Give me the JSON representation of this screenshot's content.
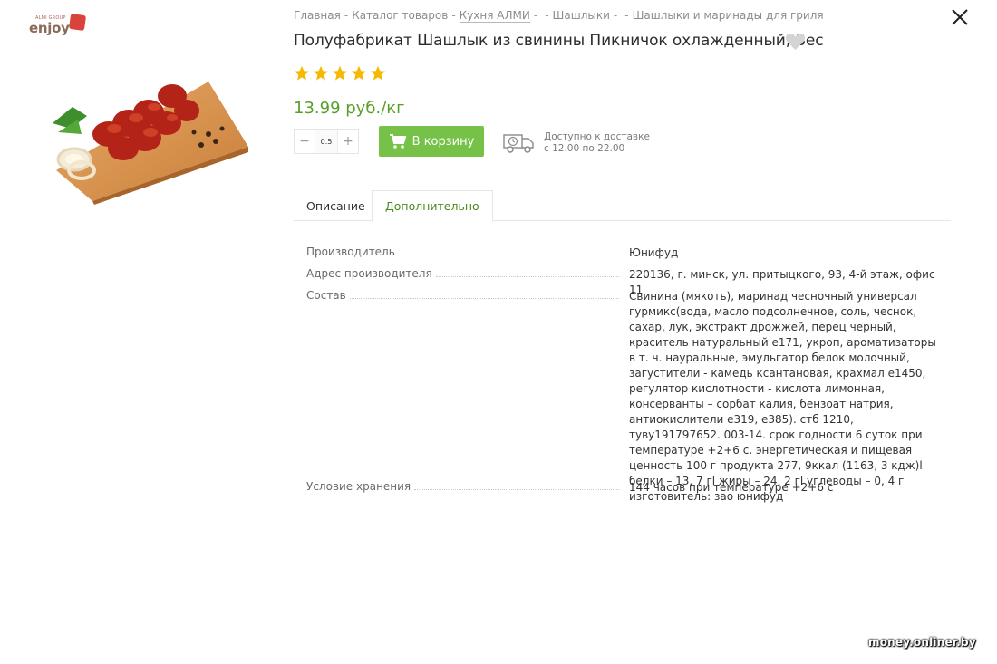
{
  "logo": {
    "tagline": "ALMI GROUP",
    "word": "enjoy"
  },
  "breadcrumb": [
    {
      "label": "Главная",
      "underlined": false
    },
    {
      "label": "Каталог товаров",
      "underlined": false
    },
    {
      "label": "Кухня АЛМИ",
      "underlined": true
    },
    {
      "label": "",
      "underlined": false
    },
    {
      "label": "Шашлыки",
      "underlined": false
    },
    {
      "label": "",
      "underlined": false
    },
    {
      "label": "Шашлыки и маринады для гриля",
      "underlined": false
    }
  ],
  "breadcrumb_separator": "-",
  "product": {
    "title": "Полуфабрикат Шашлык из свинины Пикничок охлажденный, Вес",
    "rating_stars": 5,
    "price": "13.99 руб./кг",
    "quantity": "0.5",
    "add_to_cart_label": "В корзину",
    "delivery_line1": "Доступно к доставке",
    "delivery_line2": "с 12.00 по 22.00"
  },
  "tabs": [
    {
      "label": "Описание",
      "active": false
    },
    {
      "label": "Дополнительно",
      "active": true
    }
  ],
  "specs": [
    {
      "label": "Производитель",
      "value": "Юнифуд"
    },
    {
      "label": "Адрес производителя",
      "value": "220136, г. минск, ул. притыцкого, 93, 4-й этаж, офис 11"
    },
    {
      "label": "Состав",
      "value": "Свинина (мякоть), маринад чесночный универсал гурмикс(вода, масло подсолнечное, соль, чеснок, сахар, лук, экстракт дрожжей, перец черный, краситель натуральный е171, укроп, ароматизаторы в т. ч. науральные, эмульгатор белок молочный, загустители - камедь ксантановая, крахмал е1450, регулятор кислотности - кислота лимонная, консерванты – сорбат калия, бензоат натрия, антиокислители е319, е385). стб 1210, туву191797652. 003-14. срок годности 6 суток при температуре +2+6 с. энергетическая и пищевая ценность 100 г продукта 277, 9ккал (1163, 3 кдж)l белки – 13, 7 гl жиры – 24, 2 гl углеводы – 0, 4 г изготовитель: зао юнифуд"
    },
    {
      "label": "Условие хранения",
      "value": "144 часов при температуре +2+6 с"
    }
  ],
  "watermark": "money.onliner.by",
  "colors": {
    "accent_green": "#76c248",
    "price_green": "#5a9e2a",
    "star_yellow": "#f6b800"
  },
  "icons": [
    "close-icon",
    "heart-icon",
    "star-icon",
    "cart-icon",
    "delivery-truck-icon"
  ]
}
